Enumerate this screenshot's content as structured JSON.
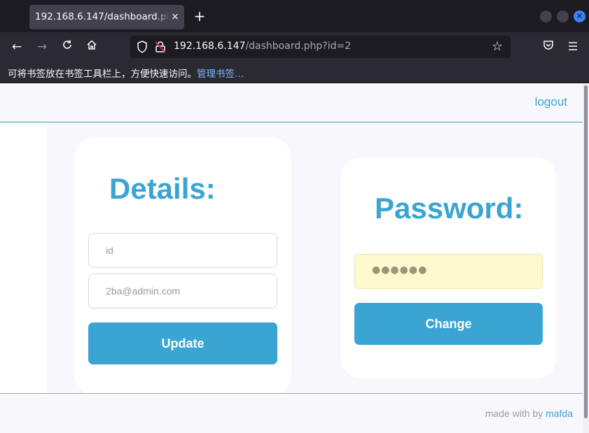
{
  "browser": {
    "tab_title": "192.168.6.147/dashboard.php?id=2",
    "tab_close": "×",
    "new_tab": "+",
    "url_host": "192.168.6.147",
    "url_path": "/dashboard.php?id=2",
    "bookmarks_hint": "可将书签放在书签工具栏上，方便快速访问。",
    "bookmarks_manage": "管理书签…",
    "icons": [
      "back-icon",
      "forward-icon",
      "reload-icon",
      "home-icon",
      "shield-icon",
      "insecure-lock-icon",
      "star-icon",
      "pocket-icon",
      "menu-icon"
    ]
  },
  "header": {
    "logout_label": "logout"
  },
  "details": {
    "heading": "Details:",
    "id_placeholder": "id",
    "email_placeholder": "2ba@admin.com",
    "update_label": "Update"
  },
  "password": {
    "heading": "Password:",
    "value_mask": "●●●●●●",
    "change_label": "Change"
  },
  "footer": {
    "made_with": "made with by",
    "author": "mafda"
  },
  "colors": {
    "accent": "#3aa4d3",
    "page_bg": "#f7f7fc",
    "autofill_bg": "#fffacd"
  }
}
